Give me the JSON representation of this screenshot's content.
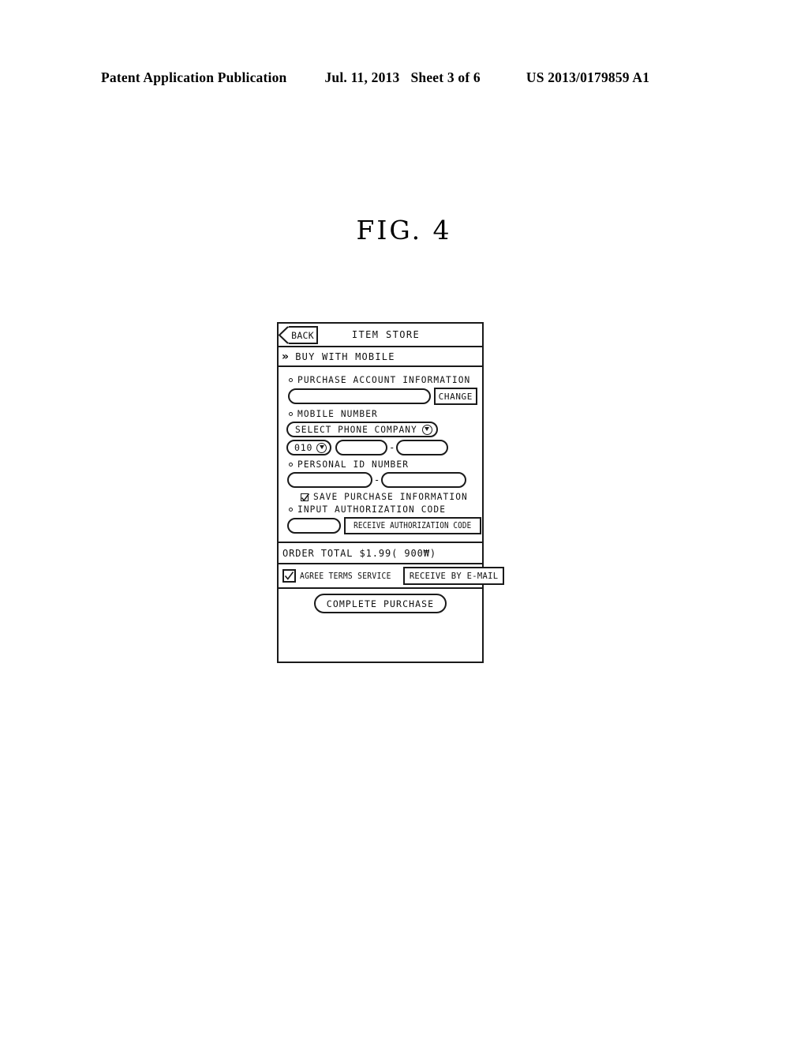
{
  "patent_header": {
    "publication": "Patent Application Publication",
    "date": "Jul. 11, 2013",
    "sheet": "Sheet 3 of 6",
    "number": "US 2013/0179859 A1"
  },
  "figure": {
    "title": "FIG.  4"
  },
  "screen": {
    "titlebar": {
      "back_label": "BACK",
      "title": "ITEM STORE"
    },
    "section": {
      "chevron": "»",
      "label": "BUY WITH MOBILE"
    },
    "fields": {
      "purchase_account": {
        "label": "PURCHASE ACCOUNT INFORMATION",
        "input_value": "",
        "change_button": "CHANGE"
      },
      "mobile_number": {
        "label": "MOBILE NUMBER",
        "carrier_select_value": "SELECT PHONE COMPANY",
        "prefix_value": "010",
        "part2_value": "",
        "part3_value": "",
        "separator": "-"
      },
      "personal_id": {
        "label": "PERSONAL ID NUMBER",
        "part1_value": "",
        "part2_value": "",
        "separator": "-"
      },
      "save_purchase": {
        "label": "SAVE PURCHASE INFORMATION",
        "checked": true
      },
      "authorization": {
        "label": "INPUT AUTHORIZATION CODE",
        "input_value": "",
        "receive_button": "RECEIVE AUTHORIZATION CODE"
      }
    },
    "order_total": {
      "text": "ORDER TOTAL $1.99( 900₩)"
    },
    "agreement": {
      "checked": true,
      "label": "AGREE TERMS SERVICE",
      "email_button": "RECEIVE BY E-MAIL"
    },
    "complete": {
      "label": "COMPLETE PURCHASE"
    }
  },
  "colors": {
    "ink": "#1a1a1a",
    "paper": "#ffffff"
  }
}
